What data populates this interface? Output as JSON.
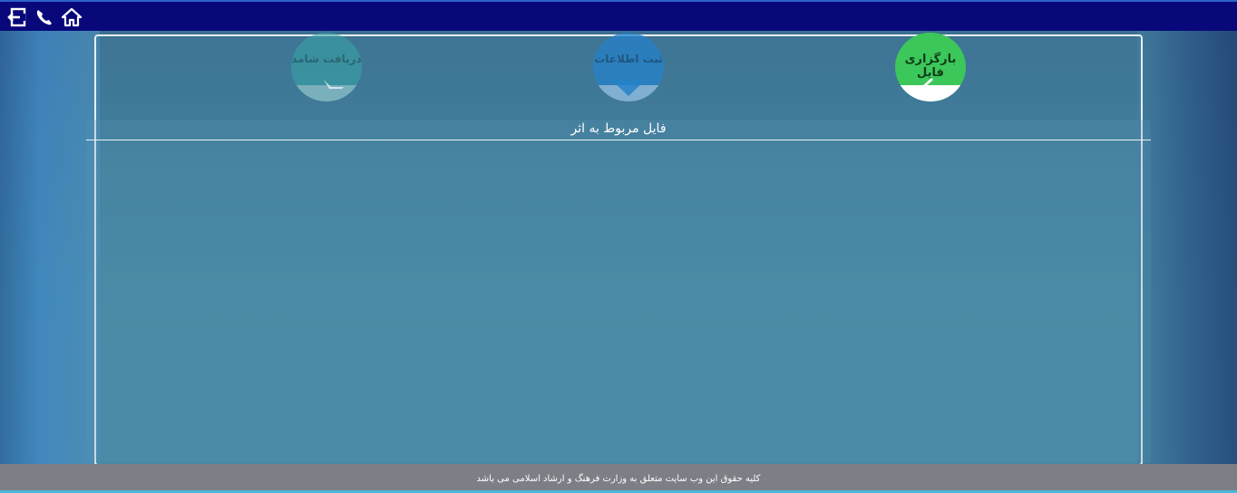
{
  "header": {
    "icons": [
      "exit-icon",
      "phone-icon",
      "home-icon"
    ]
  },
  "steps": [
    {
      "label": "بارگزاری فایل",
      "state": "active"
    },
    {
      "label": "ثبت اطلاعات",
      "state": "inactive"
    },
    {
      "label": "دریافت شامد",
      "state": "inactive"
    }
  ],
  "section": {
    "title": "فایل مربوط به اثر"
  },
  "footer": {
    "copyright": "کلیه حقوق این وب سایت متعلق به وزارت فرهنگ و ارشاد اسلامی می باشد"
  },
  "colors": {
    "topbar": "#08087a",
    "active_step": "#3cc75a",
    "footer": "#7e7f86"
  }
}
